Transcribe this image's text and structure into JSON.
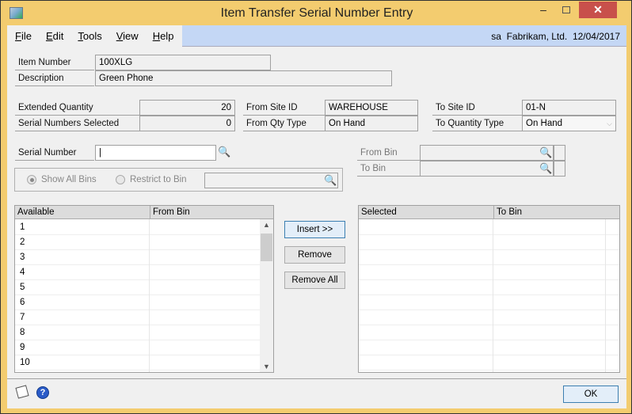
{
  "window": {
    "title": "Item Transfer Serial Number Entry",
    "minimize": "–",
    "close": "✕"
  },
  "menu": {
    "items": [
      {
        "label": "File",
        "key": "F"
      },
      {
        "label": "Edit",
        "key": "E"
      },
      {
        "label": "Tools",
        "key": "T"
      },
      {
        "label": "View",
        "key": "V"
      },
      {
        "label": "Help",
        "key": "H"
      }
    ],
    "user": "sa",
    "company": "Fabrikam, Ltd.",
    "date": "12/04/2017"
  },
  "item": {
    "number_label": "Item Number",
    "number": "100XLG",
    "description_label": "Description",
    "description": "Green Phone"
  },
  "quantities": {
    "extended_label": "Extended Quantity",
    "extended": "20",
    "selected_label": "Serial Numbers Selected",
    "selected": "0"
  },
  "from": {
    "site_label": "From Site ID",
    "site": "WAREHOUSE",
    "qty_type_label": "From Qty Type",
    "qty_type": "On Hand"
  },
  "to": {
    "site_label": "To Site ID",
    "site": "01-N",
    "qty_type_label": "To Quantity Type",
    "qty_type": "On Hand"
  },
  "serial": {
    "label": "Serial Number",
    "value": "|"
  },
  "bins": {
    "show_all": "Show All Bins",
    "restrict": "Restrict to Bin",
    "from_bin_label": "From Bin",
    "to_bin_label": "To Bin",
    "show_all_selected": true
  },
  "available_grid": {
    "columns": [
      "Available",
      "From Bin"
    ],
    "rows": [
      "1",
      "2",
      "3",
      "4",
      "5",
      "6",
      "7",
      "8",
      "9",
      "10"
    ]
  },
  "selected_grid": {
    "columns": [
      "Selected",
      "To Bin"
    ],
    "rows": []
  },
  "buttons": {
    "insert": "Insert >>",
    "remove": "Remove",
    "remove_all": "Remove All",
    "ok": "OK"
  },
  "icons": {
    "lookup": "🔍",
    "note": "note-icon",
    "help": "?"
  }
}
